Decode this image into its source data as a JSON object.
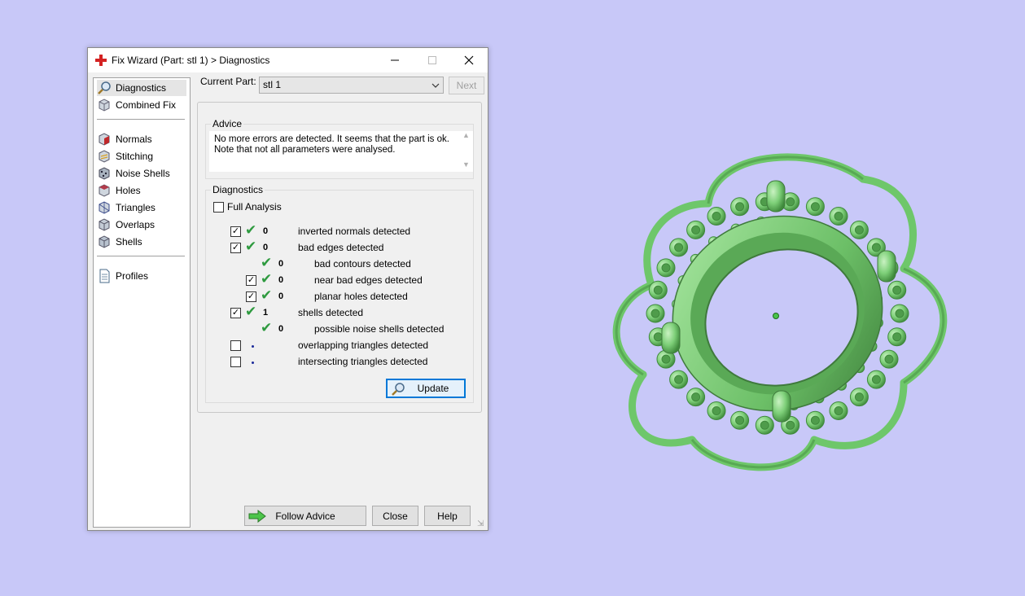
{
  "window": {
    "title": "Fix Wizard (Part: stl 1) > Diagnostics"
  },
  "sidebar": {
    "items": [
      {
        "label": "Diagnostics",
        "icon": "magnifier-icon"
      },
      {
        "label": "Combined Fix",
        "icon": "combined-fix-icon"
      },
      {
        "label": "Normals",
        "icon": "normals-cube-icon"
      },
      {
        "label": "Stitching",
        "icon": "stitching-cube-icon"
      },
      {
        "label": "Noise Shells",
        "icon": "noise-shells-icon"
      },
      {
        "label": "Holes",
        "icon": "holes-cube-icon"
      },
      {
        "label": "Triangles",
        "icon": "triangles-cube-icon"
      },
      {
        "label": "Overlaps",
        "icon": "overlaps-cube-icon"
      },
      {
        "label": "Shells",
        "icon": "shells-cube-icon"
      },
      {
        "label": "Profiles",
        "icon": "profiles-document-icon"
      }
    ]
  },
  "current_part": {
    "label": "Current Part:",
    "value": "stl 1",
    "next_label": "Next"
  },
  "advice": {
    "title": "Advice",
    "line1": "No more errors are detected. It seems that the part is ok.",
    "line2": "Note that not all parameters were analysed."
  },
  "diagnostics": {
    "title": "Diagnostics",
    "full_analysis_label": "Full Analysis",
    "rows": [
      {
        "checked": true,
        "status": "ok",
        "count": "0",
        "label": "inverted normals detected"
      },
      {
        "checked": true,
        "status": "ok",
        "count": "0",
        "label": "bad edges detected"
      },
      {
        "checked": null,
        "status": "ok",
        "count": "0",
        "label": "bad contours detected"
      },
      {
        "checked": true,
        "status": "ok",
        "count": "0",
        "label": "near bad edges detected"
      },
      {
        "checked": true,
        "status": "ok",
        "count": "0",
        "label": "planar holes detected"
      },
      {
        "checked": true,
        "status": "ok",
        "count": "1",
        "label": "shells detected"
      },
      {
        "checked": null,
        "status": "ok",
        "count": "0",
        "label": "possible noise shells detected"
      },
      {
        "checked": false,
        "status": "not-analysed",
        "count": "",
        "label": "overlapping triangles detected"
      },
      {
        "checked": false,
        "status": "not-analysed",
        "count": "",
        "label": "intersecting triangles detected"
      }
    ],
    "update_label": "Update"
  },
  "footer": {
    "follow_advice_label": "Follow Advice",
    "close_label": "Close",
    "help_label": "Help"
  },
  "colors": {
    "background": "#c8c8f8",
    "model_green": "#7dd17a",
    "check_green": "#2e9a3f",
    "focus_blue": "#0078d7"
  }
}
